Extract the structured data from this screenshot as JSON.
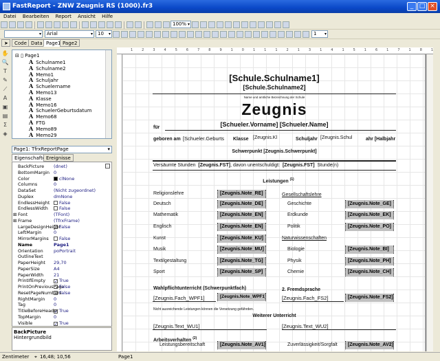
{
  "window": {
    "title": "FastReport - ZNW Zeugnis RS (1000).fr3"
  },
  "menu": [
    "Datei",
    "Bearbeiten",
    "Report",
    "Ansicht",
    "Hilfe"
  ],
  "toolbar": {
    "zoom": "100%",
    "font_name": "Arial",
    "font_size": "10",
    "style_combo": "",
    "line_width": "1"
  },
  "tabs": [
    "Code",
    "Data",
    "Page1",
    "Page2"
  ],
  "tree": {
    "root": "Page1",
    "items": [
      "Schulname1",
      "Schulname2",
      "Memo1",
      "Schuljahr",
      "Schuelername",
      "Memo13",
      "Klasse",
      "Memo16",
      "SchuelerGeburtsdatum",
      "Memo68",
      "FTG",
      "Memo89",
      "Memo29"
    ]
  },
  "inspector": {
    "object": "Page1: TfrxReportPage",
    "tabs": [
      "Eigenschaften",
      "Ereignisse"
    ],
    "props": [
      [
        "BackPicture",
        "(dnet)",
        ""
      ],
      [
        "BottomMargin",
        "0",
        ""
      ],
      [
        "Color",
        "clNone",
        "swatch"
      ],
      [
        "Columns",
        "0",
        ""
      ],
      [
        "DataSet",
        "(Nicht zugeordnet)",
        ""
      ],
      [
        "Duplex",
        "dmNone",
        ""
      ],
      [
        "EndlessHeight",
        "False",
        "off"
      ],
      [
        "EndlessWidth",
        "False",
        "off"
      ],
      [
        "Font",
        "(TFont)",
        "plus"
      ],
      [
        "Frame",
        "(TfrxFrame)",
        "plus"
      ],
      [
        "LargeDesignHeight",
        "False",
        "off"
      ],
      [
        "LeftMargin",
        "0",
        ""
      ],
      [
        "MirrorMargins",
        "False",
        "off"
      ],
      [
        "Name",
        "Page1",
        "bold"
      ],
      [
        "Orientation",
        "poPortrait",
        ""
      ],
      [
        "OutlineText",
        "",
        ""
      ],
      [
        "PaperHeight",
        "29,70",
        ""
      ],
      [
        "PaperSize",
        "A4",
        ""
      ],
      [
        "PaperWidth",
        "21",
        ""
      ],
      [
        "PrintIfEmpty",
        "True",
        "on"
      ],
      [
        "PrintOnPreviousPage",
        "False",
        "off"
      ],
      [
        "ResetPageNumbers",
        "False",
        "off"
      ],
      [
        "RightMargin",
        "0",
        ""
      ],
      [
        "Tag",
        "0",
        ""
      ],
      [
        "TitleBeforeHeader",
        "True",
        "on"
      ],
      [
        "TopMargin",
        "0",
        ""
      ],
      [
        "Visible",
        "True",
        "on"
      ]
    ],
    "desc_title": "BackPicture",
    "desc_text": "Hintergrundbild"
  },
  "status": {
    "unit": "Zentimeter",
    "coords": "16,48; 10,56",
    "page": "Page1"
  },
  "report": {
    "schulname1": "[Schule.Schulname1]",
    "schulname2": "[Schule.Schulname2]",
    "caption": "Name und amtliche Bezeichnung der Schule",
    "title": "Zeugnis",
    "fuer": "für",
    "schueler": "[Schueler.Vorname] [Schueler.Name]",
    "geboren": "geboren am",
    "geburt": "[Schueler.Geburts",
    "klasse_l": "Klasse",
    "klasse": "[Zeugnis.Kl",
    "schuljahr_l": "Schuljahr",
    "schuljahr": "[Zeugnis.Schul",
    "halbjahr": "ahr [Halbjahr",
    "schwerpunkt": "Schwerpunkt [Zeugnis.Schwerpunkt]",
    "fehl1": "Versäumte Stunden",
    "fst1": "[Zeugnis.FST]",
    "fehl2": ", davon unentschuldigt:",
    "fst2": "[Zeugnis.FST]",
    "fehl3": "Stunde(n)",
    "leistungen": "Leistungen",
    "fn1": "(1)",
    "left": [
      [
        "Religionslehre",
        "[Zeugnis.Note_RE]"
      ],
      [
        "Deutsch",
        "[Zeugnis.Note_DE]"
      ],
      [
        "Mathematik",
        "[Zeugnis.Note_EN]"
      ],
      [
        "Englisch",
        "[Zeugnis.Note_EN]"
      ],
      [
        "Kunst",
        "[Zeugnis.Note_KU]"
      ],
      [
        "Musik",
        "[Zeugnis.Note_MU]"
      ],
      [
        "Textilgestaltung",
        "[Zeugnis.Note_TG]"
      ],
      [
        "Sport",
        "[Zeugnis.Note_SP]"
      ]
    ],
    "gesellschaft": "Gesellschaftslehre",
    "natur": "Naturwissenschaften",
    "right": [
      [
        "Geschichte",
        "[Zeugnis.Note_GE]"
      ],
      [
        "Erdkunde",
        "[Zeugnis.Note_EK]"
      ],
      [
        "Politik",
        "[Zeugnis.Note_PO]"
      ],
      [
        "Biologie",
        "[Zeugnis.Note_BI]"
      ],
      [
        "Physik",
        "[Zeugnis.Note_PH]"
      ],
      [
        "Chemie",
        "[Zeugnis.Note_CH]"
      ]
    ],
    "wpf_head": "Wahlpflichtunterricht (Schwerpunktfach)",
    "wpf_fach": "[Zeugnis.Fach_WPF1]",
    "wpf_note": "[Zeugnis.Note_WPF1]",
    "fs_head": "2. Fremdsprache",
    "fs_fach": "[Zeugnis.Fach_FS2]",
    "fs_note": "[Zeugnis.Note_FS2]",
    "hinweis": "Nicht ausreichende Leistungen können die Versetzung gefährden.",
    "weiterer": "Weiterer Unterricht",
    "wu1": "[Zeugnis.Text_WU1]",
    "wu2": "[Zeugnis.Text_WU2]",
    "arbeit": "Arbeitsverhalten",
    "fn2": "(2)",
    "av1_l": "Leistungsbereitschaft",
    "av1": "[Zeugnis.Note_AV1]",
    "av2_l": "Zuverlässigkeit/Sorgfalt",
    "av2": "[Zeugnis.Note_AV2]"
  }
}
